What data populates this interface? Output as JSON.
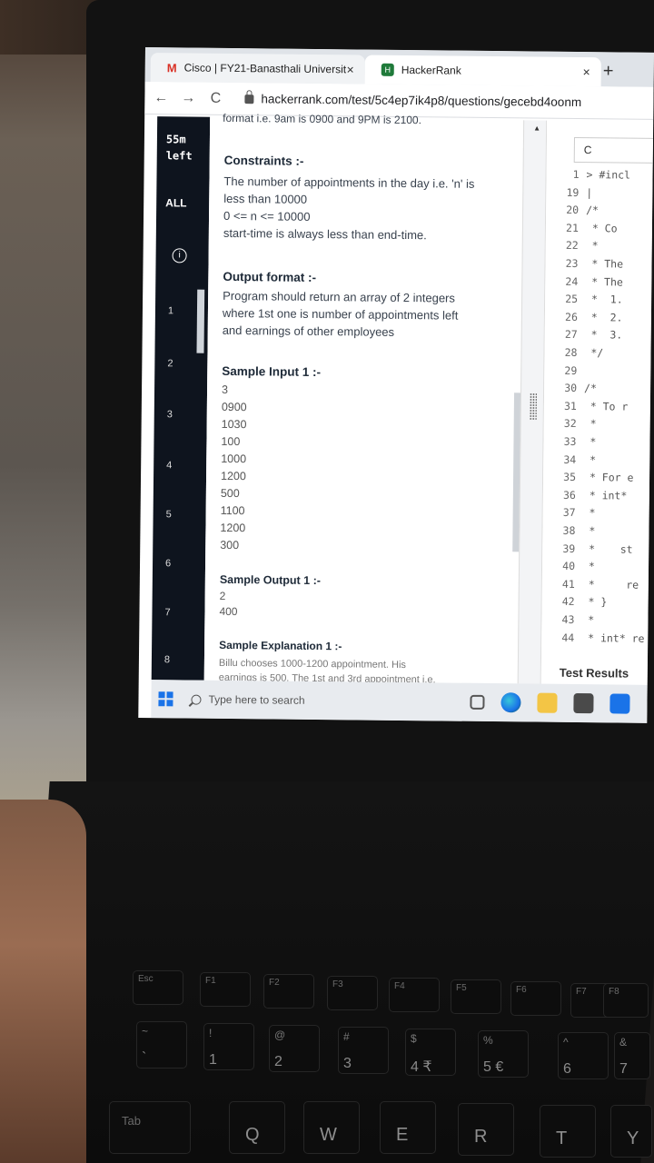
{
  "browser": {
    "tabs": [
      {
        "label": "Cisco | FY21-Banasthali Universit",
        "icon": "gmail-icon"
      },
      {
        "label": "HackerRank",
        "icon": "hackerrank-icon"
      }
    ],
    "close_glyph": "×",
    "new_tab_glyph": "+",
    "back_glyph": "←",
    "forward_glyph": "→",
    "reload_glyph": "C",
    "url": "hackerrank.com/test/5c4ep7ik4p8/questions/gecebd4oonm"
  },
  "sidebar": {
    "time_value": "55m",
    "time_label": "left",
    "all_label": "ALL",
    "info_glyph": "i",
    "questions": [
      "1",
      "2",
      "3",
      "4",
      "5",
      "6",
      "7",
      "8"
    ]
  },
  "problem": {
    "cut_line": "format i.e. 9am is 0900 and 9PM is 2100.",
    "constraints": {
      "heading": "Constraints :-",
      "lines": [
        "The number of appointments in the day i.e. 'n' is",
        "less than 10000",
        "0 <= n <= 10000",
        "start-time is always less than end-time."
      ]
    },
    "output_format": {
      "heading": "Output format :-",
      "lines": [
        "Program should return an array of 2 integers",
        "where 1st one is number of appointments left",
        "and earnings of other employees"
      ]
    },
    "sample_input": {
      "heading": "Sample Input 1 :-",
      "lines": [
        "3",
        "0900",
        "1030",
        "100",
        "1000",
        "1200",
        "500",
        "1100",
        "1200",
        "300"
      ]
    },
    "sample_output": {
      "heading": "Sample Output 1 :-",
      "lines": [
        "2",
        "400"
      ]
    },
    "sample_explanation": {
      "heading": "Sample Explanation 1 :-",
      "lines": [
        "Billu chooses 1000-1200 appointment. His",
        "earnings is 500. The 1st and 3rd appointment i.e."
      ]
    }
  },
  "editor": {
    "language": "C",
    "lines": [
      {
        "n": "1",
        "code": "> #incl"
      },
      {
        "n": "19",
        "code": "|"
      },
      {
        "n": "20",
        "code": "/*"
      },
      {
        "n": "21",
        "code": " * Co"
      },
      {
        "n": "22",
        "code": " *"
      },
      {
        "n": "23",
        "code": " * The"
      },
      {
        "n": "24",
        "code": " * The"
      },
      {
        "n": "25",
        "code": " *  1."
      },
      {
        "n": "26",
        "code": " *  2."
      },
      {
        "n": "27",
        "code": " *  3."
      },
      {
        "n": "28",
        "code": " */"
      },
      {
        "n": "29",
        "code": ""
      },
      {
        "n": "30",
        "code": "/*"
      },
      {
        "n": "31",
        "code": " * To r"
      },
      {
        "n": "32",
        "code": " *"
      },
      {
        "n": "33",
        "code": " *"
      },
      {
        "n": "34",
        "code": " *"
      },
      {
        "n": "35",
        "code": " * For e"
      },
      {
        "n": "36",
        "code": " * int* "
      },
      {
        "n": "37",
        "code": " *"
      },
      {
        "n": "38",
        "code": " *"
      },
      {
        "n": "39",
        "code": " *    st"
      },
      {
        "n": "40",
        "code": " *"
      },
      {
        "n": "41",
        "code": " *     re"
      },
      {
        "n": "42",
        "code": " * }"
      },
      {
        "n": "43",
        "code": " *"
      },
      {
        "n": "44",
        "code": " * int* re"
      }
    ],
    "test_results_label": "Test Results"
  },
  "taskbar": {
    "search_placeholder": "Type here to search"
  },
  "keyboard": {
    "fn_keys": [
      "Esc",
      "F1",
      "F2",
      "F3",
      "F4",
      "F5",
      "F6",
      "F7",
      "F8"
    ],
    "number_keys": [
      {
        "top": "~",
        "bot": "`"
      },
      {
        "top": "!",
        "bot": "1"
      },
      {
        "top": "@",
        "bot": "2"
      },
      {
        "top": "#",
        "bot": "3"
      },
      {
        "top": "$",
        "bot": "4 ₹"
      },
      {
        "top": "%",
        "bot": "5 €"
      },
      {
        "top": "^",
        "bot": "6"
      },
      {
        "top": "&",
        "bot": "7"
      }
    ],
    "tab_label": "Tab",
    "letter_keys": [
      "Q",
      "W",
      "E",
      "R",
      "T",
      "Y"
    ]
  }
}
